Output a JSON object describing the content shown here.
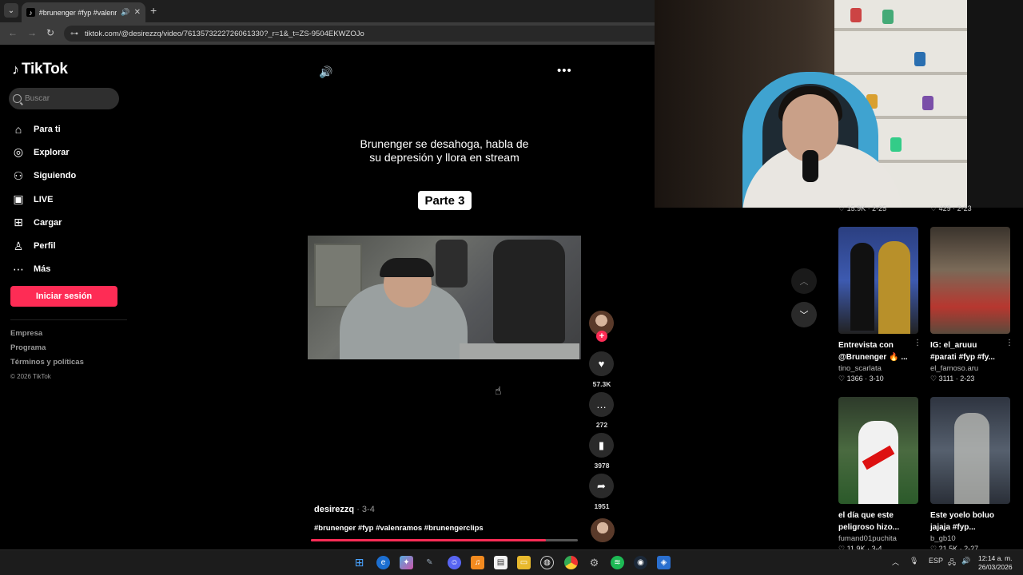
{
  "browser": {
    "tab_title": "#brunenger #fyp #valenramos",
    "url": "tiktok.com/@desirezzq/video/7613573222726061330?_r=1&_t=ZS-9504EKWZOJo"
  },
  "sidebar": {
    "logo": "TikTok",
    "search_placeholder": "Buscar",
    "items": [
      {
        "label": "Para ti"
      },
      {
        "label": "Explorar"
      },
      {
        "label": "Siguiendo"
      },
      {
        "label": "LIVE"
      },
      {
        "label": "Cargar"
      },
      {
        "label": "Perfil"
      },
      {
        "label": "Más"
      }
    ],
    "login_label": "Iniciar sesión",
    "footer": [
      "Empresa",
      "Programa",
      "Términos y políticas"
    ],
    "copyright": "© 2026 TikTok"
  },
  "video": {
    "caption": "Brunenger se desahoga, habla de su depresión y llora en stream",
    "part_label": "Parte 3",
    "author": "desirezzq",
    "date": " · 3-4",
    "hashtags": "#brunenger #fyp #valenramos #brunengerclips",
    "progress": 0.88
  },
  "actions": {
    "likes": "57.3K",
    "comments": "272",
    "saves": "3978",
    "shares": "1951"
  },
  "recommendations": {
    "top_stats": [
      {
        "likes": "15.9K",
        "date": "2-25"
      },
      {
        "likes": "429",
        "date": "2-23"
      }
    ],
    "cards": [
      {
        "title_line1": "Entrevista con",
        "title_line2": "@Brunenger 🔥 ...",
        "author": "tino_scarlata",
        "likes": "1366",
        "date": "3-10"
      },
      {
        "title_line1": "IG: el_aruuu",
        "title_line2": "#parati #fyp #fy...",
        "author": "el_famoso.aru",
        "likes": "3111",
        "date": "2-23"
      },
      {
        "title_line1": "el día que este",
        "title_line2": "peligroso hizo...",
        "author": "fumand01puchita",
        "likes": "11.9K",
        "date": "3-4"
      },
      {
        "title_line1": "Este yoelo boluo",
        "title_line2": "jajaja #fyp...",
        "author": "b_gb10",
        "likes": "21.5K",
        "date": "2-27"
      }
    ]
  },
  "taskbar": {
    "lang": "ESP",
    "time": "12:14 a. m.",
    "date": "26/03/2026"
  },
  "colors": {
    "accent": "#fe2c55",
    "background": "#000000"
  }
}
